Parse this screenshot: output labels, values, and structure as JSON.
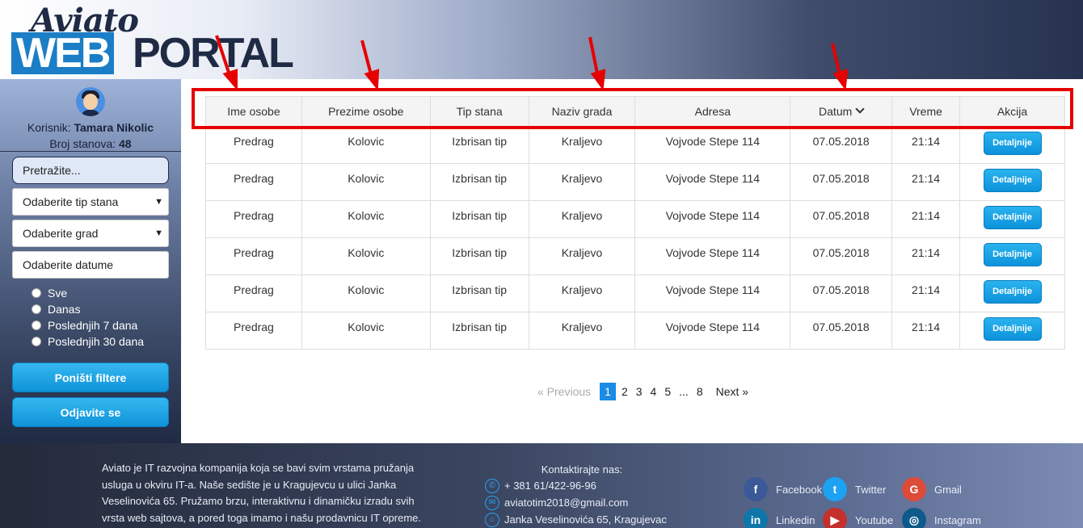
{
  "logo": {
    "top": "Aviato",
    "web": "WEB",
    "portal": "PORTAL"
  },
  "sidebar": {
    "user_label": "Korisnik:",
    "user_name": "Tamara Nikolic",
    "count_label": "Broj stanova:",
    "count_value": "48",
    "search_placeholder": "Pretražite...",
    "select_type": "Odaberite tip stana",
    "select_city": "Odaberite grad",
    "select_dates": "Odaberite datume",
    "radios": [
      "Sve",
      "Danas",
      "Poslednjih 7 dana",
      "Poslednjih 30 dana"
    ],
    "reset_button": "Poništi filtere",
    "logout_button": "Odjavite se"
  },
  "table": {
    "headers": [
      "Ime osobe",
      "Prezime osobe",
      "Tip stana",
      "Naziv grada",
      "Adresa",
      "Datum",
      "Vreme",
      "Akcija"
    ],
    "rows": [
      [
        "Predrag",
        "Kolovic",
        "Izbrisan tip",
        "Kraljevo",
        "Vojvode Stepe 114",
        "07.05.2018",
        "21:14"
      ],
      [
        "Predrag",
        "Kolovic",
        "Izbrisan tip",
        "Kraljevo",
        "Vojvode Stepe 114",
        "07.05.2018",
        "21:14"
      ],
      [
        "Predrag",
        "Kolovic",
        "Izbrisan tip",
        "Kraljevo",
        "Vojvode Stepe 114",
        "07.05.2018",
        "21:14"
      ],
      [
        "Predrag",
        "Kolovic",
        "Izbrisan tip",
        "Kraljevo",
        "Vojvode Stepe 114",
        "07.05.2018",
        "21:14"
      ],
      [
        "Predrag",
        "Kolovic",
        "Izbrisan tip",
        "Kraljevo",
        "Vojvode Stepe 114",
        "07.05.2018",
        "21:14"
      ],
      [
        "Predrag",
        "Kolovic",
        "Izbrisan tip",
        "Kraljevo",
        "Vojvode Stepe 114",
        "07.05.2018",
        "21:14"
      ]
    ],
    "action_label": "Detaljnije"
  },
  "pagination": {
    "prev": "«  Previous",
    "pages": [
      "1",
      "2",
      "3",
      "4",
      "5",
      "...",
      "8"
    ],
    "active": "1",
    "next": "Next  »"
  },
  "footer": {
    "about": "Aviato je IT razvojna kompanija koja se bavi svim vrstama pružanja usluga u okviru IT-a. Naše sedište je u Kragujevcu u ulici Janka Veselinovića 65. Pružamo brzu, interaktivnu i dinamičku izradu svih vrsta web sajtova, a pored toga imamo i našu prodavnicu IT opreme.",
    "contact_title": "Kontaktirajte nas:",
    "phone": "+ 381 61/422-96-96",
    "email": "aviatotim2018@gmail.com",
    "address": "Janka Veselinovića 65, Kragujevac",
    "social": [
      {
        "name": "Facebook",
        "icon": "facebook-icon",
        "color": "#3b5998",
        "glyph": "f"
      },
      {
        "name": "Twitter",
        "icon": "twitter-icon",
        "color": "#1da1f2",
        "glyph": "t"
      },
      {
        "name": "Gmail",
        "icon": "gmail-icon",
        "color": "#dd4b39",
        "glyph": "G"
      },
      {
        "name": "Linkedin",
        "icon": "linkedin-icon",
        "color": "#0e76a8",
        "glyph": "in"
      },
      {
        "name": "Youtube",
        "icon": "youtube-icon",
        "color": "#c4302b",
        "glyph": "▶"
      },
      {
        "name": "Instagram",
        "icon": "instagram-icon",
        "color": "#0e5a8a",
        "glyph": "◎"
      }
    ]
  },
  "colors": {
    "accent": "#1b8be3",
    "button": "#0f93d9",
    "annotation": "#e60000"
  }
}
